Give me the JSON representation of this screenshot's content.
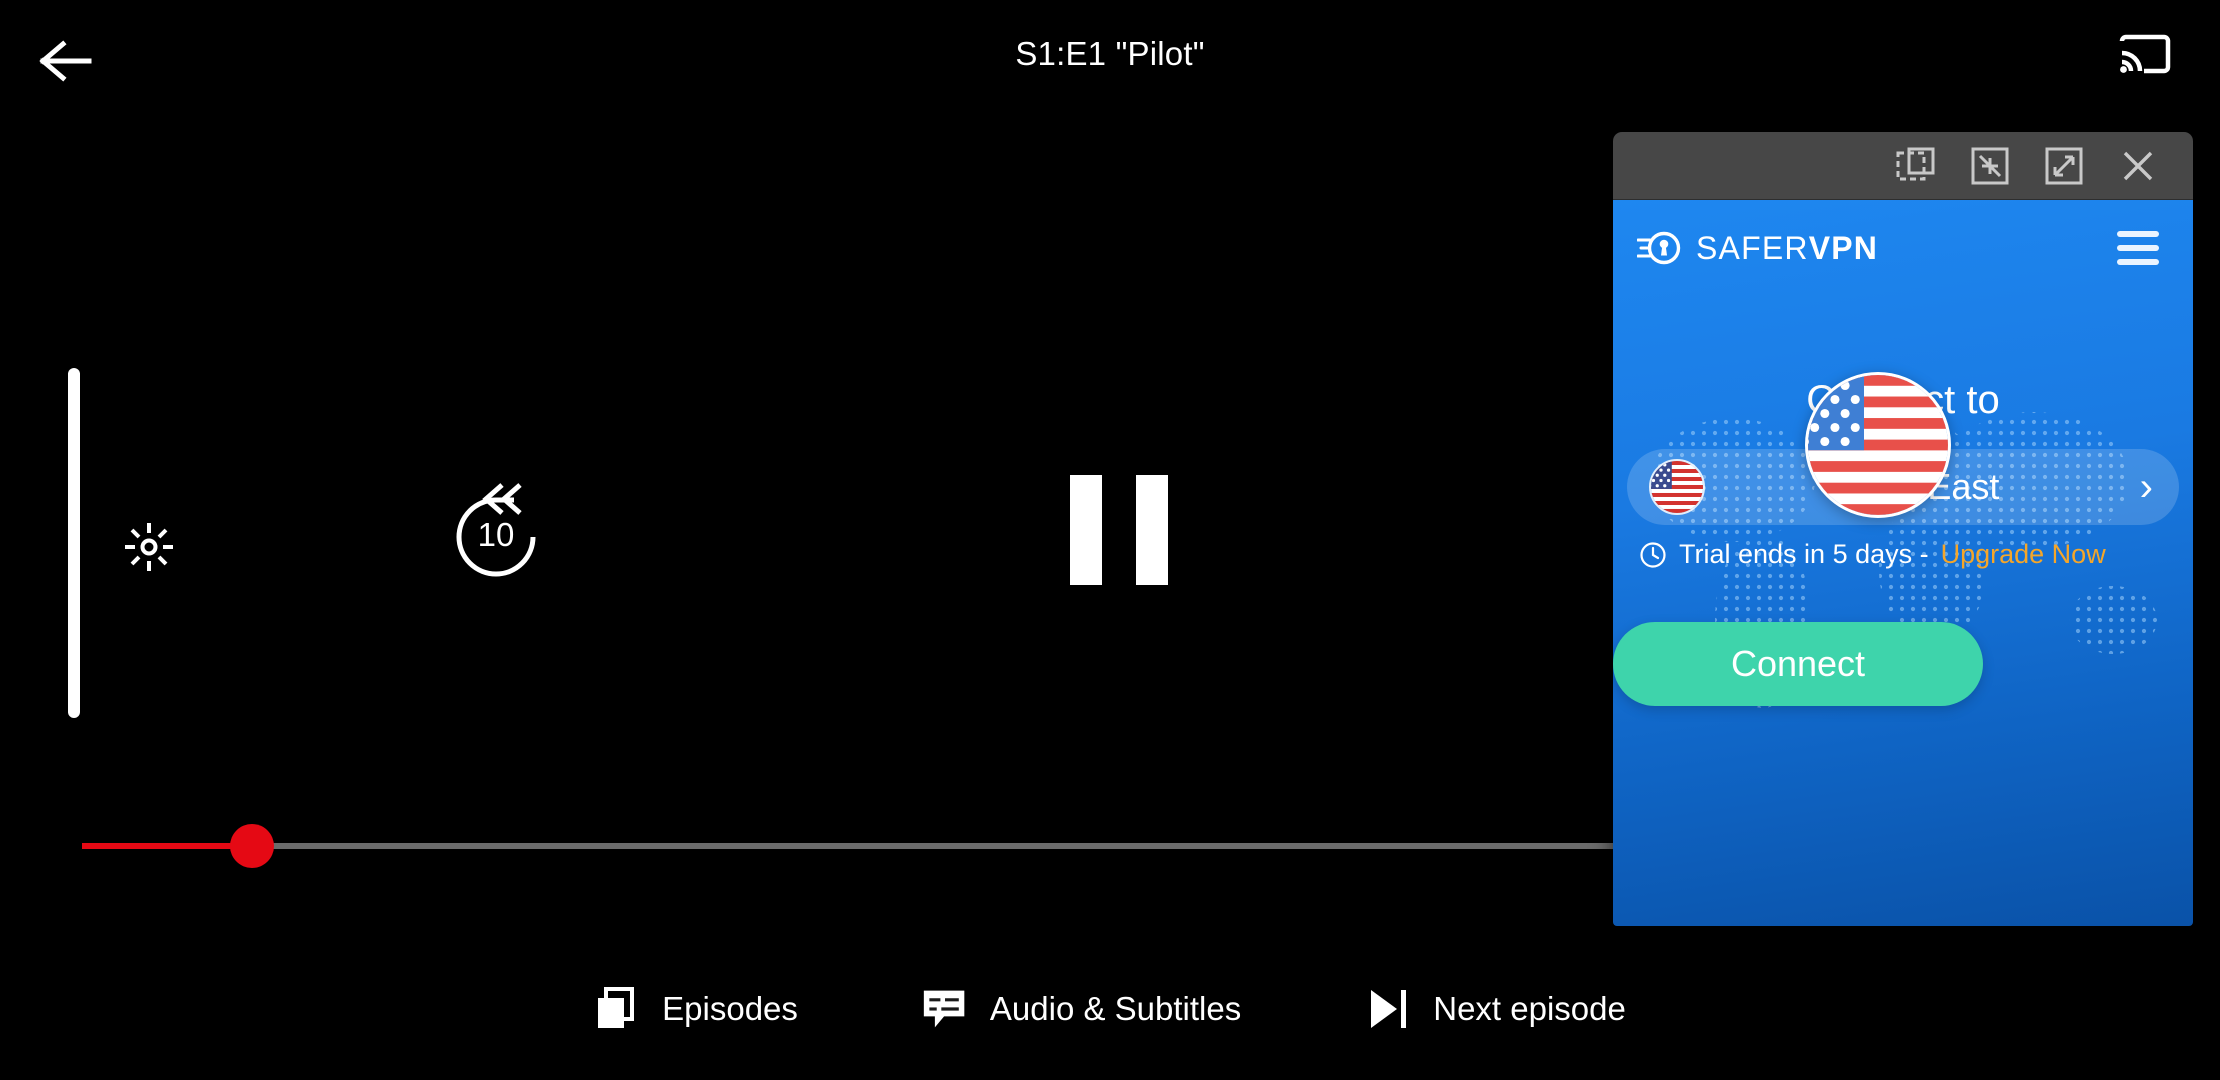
{
  "player": {
    "title": "S1:E1 \"Pilot\"",
    "back_icon": "arrow-left-icon",
    "cast_icon": "chromecast-icon",
    "brightness_icon": "brightness-sun-icon",
    "rewind_label": "10",
    "rewind_icon": "rewind-10-icon",
    "pause_icon": "pause-icon",
    "progress": {
      "played_percent": 8,
      "filled_color": "#e50914",
      "track_color": "#6b6b6b"
    },
    "bottom_controls": [
      {
        "label": "Episodes",
        "icon": "episodes-stack-icon"
      },
      {
        "label": "Audio & Subtitles",
        "icon": "subtitles-icon"
      },
      {
        "label": "Next episode",
        "icon": "skip-next-icon"
      }
    ]
  },
  "vpn": {
    "titlebar": {
      "buttons": [
        {
          "name": "picture-in-picture",
          "icon": "pip-icon"
        },
        {
          "name": "minimize",
          "icon": "collapse-arrows-icon"
        },
        {
          "name": "maximize",
          "icon": "expand-arrows-icon"
        },
        {
          "name": "close",
          "icon": "close-x-icon"
        }
      ],
      "background": "#474747"
    },
    "brand": {
      "name_light": "SAFER",
      "name_bold": "VPN",
      "logo_icon": "safervpn-keyhole-icon"
    },
    "menu_icon": "hamburger-menu-icon",
    "heading": "Connect to",
    "location": {
      "name": "USA East",
      "flag": "us-flag",
      "chevron": "chevron-right-icon"
    },
    "trial": {
      "clock_icon": "clock-icon",
      "text": "Trial ends in 5 days - ",
      "upgrade_label": "Upgrade Now",
      "upgrade_color": "#f4a62a"
    },
    "connect_button": {
      "label": "Connect",
      "color": "#3ed4ab"
    },
    "accent_blue": "#1e87f0"
  }
}
